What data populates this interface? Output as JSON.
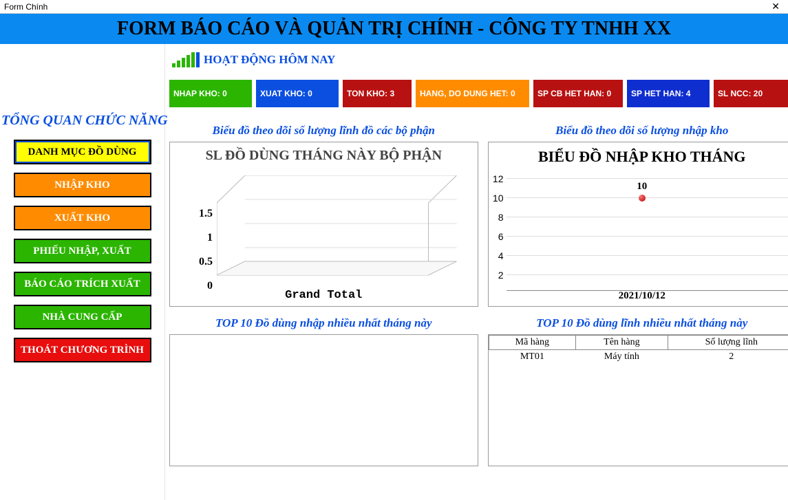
{
  "window_title": "Form Chính",
  "banner": "FORM BÁO CÁO VÀ QUẢN TRỊ CHÍNH - CÔNG TY TNHH XX",
  "sidebar": {
    "header": "TỔNG QUAN CHỨC NĂNG",
    "items": [
      {
        "label": "DANH MỤC ĐỒ DÙNG"
      },
      {
        "label": "NHẬP KHO"
      },
      {
        "label": "XUẤT KHO"
      },
      {
        "label": "PHIẾU NHẬP, XUẤT"
      },
      {
        "label": "BÁO CÁO TRÍCH XUẤT"
      },
      {
        "label": "NHÀ CUNG CẤP"
      },
      {
        "label": "THOÁT CHƯƠNG TRÌNH"
      }
    ]
  },
  "activity_label": "HOẠT ĐỘNG HÔM NAY",
  "stats": [
    {
      "label": "NHAP KHO: 0"
    },
    {
      "label": "XUAT KHO: 0"
    },
    {
      "label": "TON KHO: 3"
    },
    {
      "label": "HANG, DO DUNG HET: 0"
    },
    {
      "label": "SP CB HET HAN: 0"
    },
    {
      "label": "SP HET HAN: 4"
    },
    {
      "label": "SL NCC: 20"
    }
  ],
  "chart_left": {
    "title_panel": "Biểu đồ theo dõi số lượng lĩnh đồ các bộ phận",
    "title": "SL  ĐỒ DÙNG THÁNG NÀY BỘ PHẬN",
    "xlabel": "Grand Total"
  },
  "chart_right": {
    "title_panel": "Biểu đồ theo dõi số lượng nhập kho",
    "title": "BIỂU ĐỒ NHẬP KHO THÁNG",
    "point_label": "10",
    "xlabel": "2021/10/12"
  },
  "top_left_title": "TOP 10 Đồ dùng nhập nhiều nhất tháng này",
  "top_right_title": "TOP 10 Đồ dùng lĩnh nhiều nhất tháng này",
  "table": {
    "headers": [
      "Mã hàng",
      "Tên hàng",
      "Số lượng lĩnh"
    ],
    "rows": [
      [
        "MT01",
        "Máy tính",
        "2"
      ]
    ]
  },
  "chart_data": [
    {
      "type": "bar",
      "title": "SL ĐỒ DÙNG THÁNG NÀY BỘ PHẬN",
      "categories": [
        "Grand Total"
      ],
      "values": [
        0
      ],
      "ylim": [
        0,
        1.5
      ],
      "yticks": [
        0,
        0.5,
        1,
        1.5
      ]
    },
    {
      "type": "line",
      "title": "BIỂU ĐỒ NHẬP KHO THÁNG",
      "x": [
        "2021/10/12"
      ],
      "values": [
        10
      ],
      "ylim": [
        0,
        12
      ],
      "yticks": [
        2,
        4,
        6,
        8,
        10,
        12
      ]
    }
  ],
  "yticks_left": [
    "1.5",
    "1",
    "0.5",
    "0"
  ],
  "yticks_right": [
    "12",
    "10",
    "8",
    "6",
    "4",
    "2"
  ]
}
